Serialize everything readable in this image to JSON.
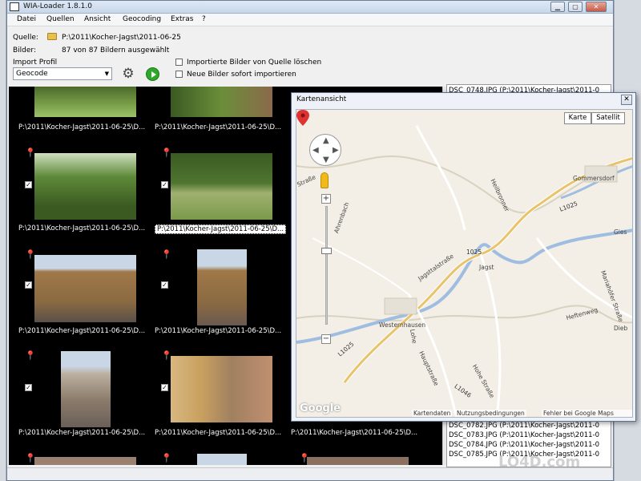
{
  "window": {
    "title": "WIA-Loader 1.8.1.0"
  },
  "menu": [
    "Datei",
    "Quellen",
    "Ansicht",
    "Geocoding",
    "Extras",
    "?"
  ],
  "form": {
    "quelle_label": "Quelle:",
    "quelle_value": "P:\\2011\\Kocher-Jagst\\2011-06-25",
    "bilder_label": "Bilder:",
    "bilder_value": "87 von 87 Bildern ausgewählt",
    "import_profil_label": "Import Profil",
    "profile_value": "Geocode",
    "checkbox1_label": "Importierte Bilder von Quelle löschen",
    "checkbox2_label": "Neue Bilder sofort importieren"
  },
  "gallery": {
    "caption": "P:\\2011\\Kocher-Jagst\\2011-06-25\\D...",
    "selected_caption": "P:\\2011\\Kocher-Jagst\\2011-06-25\\D...",
    "check_mark": "✓"
  },
  "file_list": [
    "DSC_0748.JPG   (P:\\2011\\Kocher-Jagst\\2011-0",
    "DSC_0782.JPG   (P:\\2011\\Kocher-Jagst\\2011-0",
    "DSC_0783.JPG   (P:\\2011\\Kocher-Jagst\\2011-0",
    "DSC_0784.JPG   (P:\\2011\\Kocher-Jagst\\2011-0",
    "DSC_0785.JPG   (P:\\2011\\Kocher-Jagst\\2011-0"
  ],
  "map": {
    "title": "Kartenansicht",
    "close": "✕",
    "type_karte": "Karte",
    "type_satellit": "Satellit",
    "zoom_in": "+",
    "zoom_out": "−",
    "google": "Google",
    "footer_kartendaten": "Kartendaten",
    "footer_nutzung": "Nutzungsbedingungen",
    "footer_fehler": "Fehler bei Google Maps melden",
    "labels": {
      "gommersdorf": "Gommersdorf",
      "westernhausen": "Westernhausen",
      "jagst": "Jagst",
      "jagstalstrasse": "Jagsttalstraße",
      "hauptstrasse": "Hauptstraße",
      "hohe_strasse": "Hohe Straße",
      "mariahof": "Mariahöfer Straße",
      "l1025a": "L1025",
      "l1025b": "1025",
      "l1025c": "L1025",
      "l1046": "L1046",
      "l1025_left": "L1025",
      "strasse": "Straße",
      "a_bach": "Ahrenbach",
      "heilbronner": "Heilbronner",
      "gies": "Gies",
      "dieb": "Dieb",
      "lohe": "Lohe",
      "heftenweg": "Heftenweg"
    }
  },
  "watermark": "LO4D.com"
}
